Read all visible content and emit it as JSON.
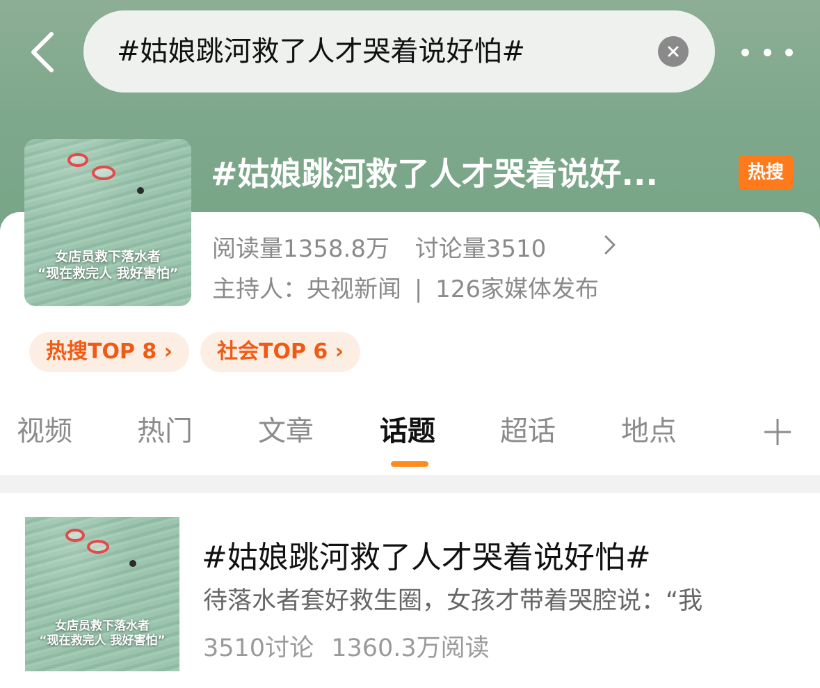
{
  "search": {
    "query": "#姑娘跳河救了人才哭着说好怕#"
  },
  "topic": {
    "title": "#姑娘跳河救了人才哭着说好...",
    "badge": "热搜",
    "reads": "阅读量1358.8万",
    "discussions": "讨论量3510",
    "host": "主持人：央视新闻",
    "separator": "|",
    "media": "126家媒体发布",
    "thumb_caption_line1": "女店员救下落水者",
    "thumb_caption_line2": "“现在救完人 我好害怕”"
  },
  "ranks": [
    {
      "label": "热搜TOP 8 ›"
    },
    {
      "label": "社会TOP 6 ›"
    }
  ],
  "tabs": [
    {
      "label": "视频"
    },
    {
      "label": "热门"
    },
    {
      "label": "文章"
    },
    {
      "label": "话题",
      "active": true
    },
    {
      "label": "超话"
    },
    {
      "label": "地点"
    }
  ],
  "result": {
    "title": "#姑娘跳河救了人才哭着说好怕#",
    "description": "待落水者套好救生圈，女孩才带着哭腔说：“我",
    "discussions": "3510讨论",
    "reads": "1360.3万阅读",
    "thumb_caption_line1": "女店员救下落水者",
    "thumb_caption_line2": "“现在救完人 我好害怕”"
  },
  "colors": {
    "header_bg": "#7ea88c",
    "accent_orange": "#ff7a1a",
    "rank_text": "#f05a14",
    "rank_bg": "#fdeee4"
  },
  "icons": [
    "back-arrow-icon",
    "clear-icon",
    "more-icon",
    "chevron-right-icon",
    "plus-icon"
  ]
}
